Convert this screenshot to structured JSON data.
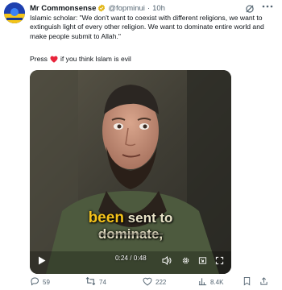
{
  "author": {
    "name": "Mr Commonsense",
    "handle": "@fopminui",
    "separator": "·",
    "time": "10h"
  },
  "post": {
    "text": "Islamic scholar: \"We don't want to coexist with different religions, we want to extinguish light of every other religion. We want to dominate entire world and make people submit to Allah.\"",
    "press_label": "Press",
    "prompt_rest": "if you think Islam is evil"
  },
  "video": {
    "caption_highlight": "been",
    "caption_rest": "sent to",
    "caption_line2": "dominate,",
    "timecode": "0:24 / 0:48"
  },
  "actions": {
    "replies": "59",
    "reposts": "74",
    "likes": "222",
    "views": "8.4K"
  },
  "colors": {
    "accent_blue": "#1d9bf0",
    "heart_red": "#e8243b",
    "verified_gold": "#e2b719",
    "muted_text": "#536471"
  },
  "icons": [
    "grok-icon",
    "more-icon",
    "verified-icon",
    "heart-emoji-icon",
    "play-icon",
    "volume-icon",
    "settings-icon",
    "pip-icon",
    "fullscreen-icon",
    "reply-icon",
    "repost-icon",
    "like-icon",
    "views-icon",
    "bookmark-icon",
    "share-icon"
  ]
}
